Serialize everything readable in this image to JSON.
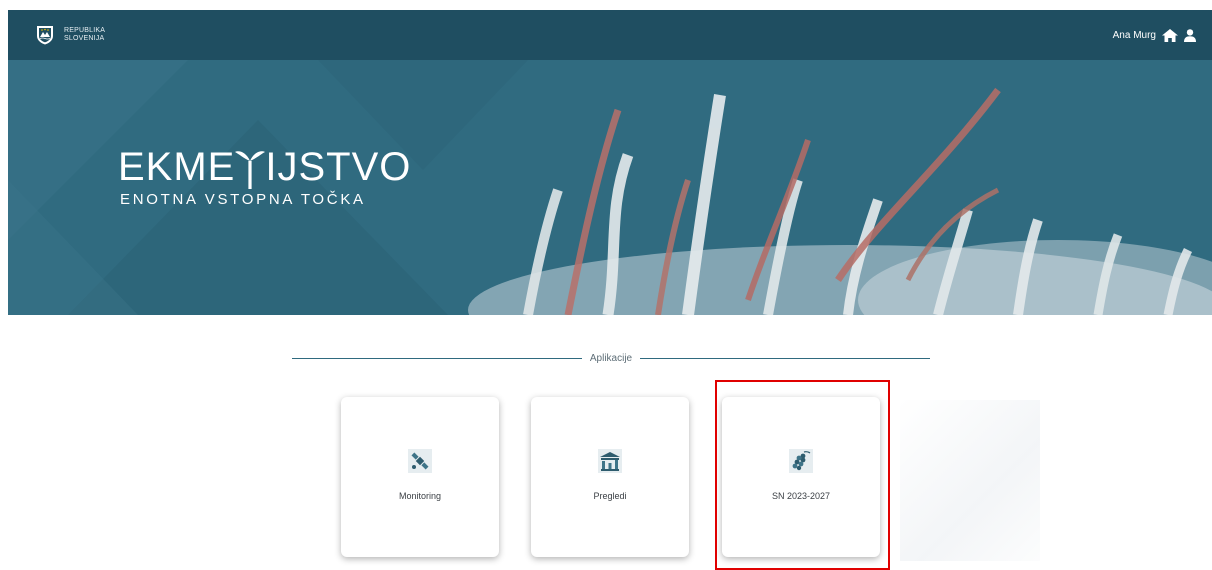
{
  "header": {
    "brand_line1": "REPUBLIKA",
    "brand_line2": "SLOVENIJA",
    "crest_icon": "slovenia-crest-icon",
    "user_name": "Ana Murg",
    "home_icon": "home-icon",
    "user_icon": "user-icon"
  },
  "hero": {
    "logo_title_start": "EKME",
    "logo_title_end": "IJSTVO",
    "logo_subtitle": "ENOTNA VSTOPNA TOČKA"
  },
  "apps": {
    "section_label": "Aplikacije",
    "items": [
      {
        "label": "Monitoring",
        "icon": "satellite-icon"
      },
      {
        "label": "Pregledi",
        "icon": "building-chart-icon"
      },
      {
        "label": "SN 2023-2027",
        "icon": "grapes-icon"
      }
    ]
  },
  "colors": {
    "header_bg": "#1f4e61",
    "hero_bg": "#306b80",
    "accent_line": "#2f6a7f",
    "highlight": "#e00000"
  }
}
